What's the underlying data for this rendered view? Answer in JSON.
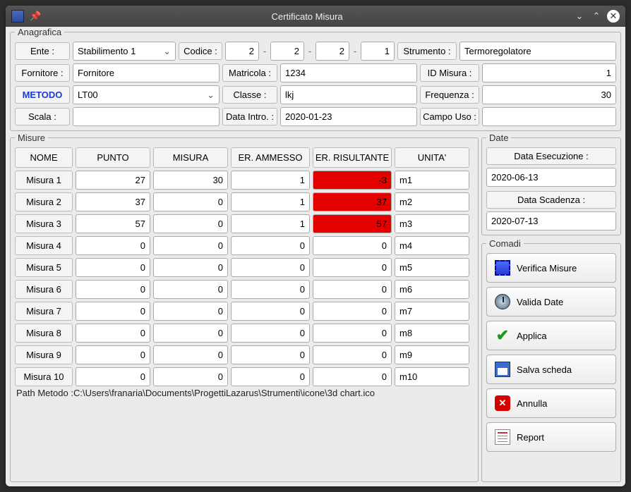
{
  "window": {
    "title": "Certificato Misura"
  },
  "anagrafica": {
    "legend": "Anagrafica",
    "ente_lbl": "Ente :",
    "ente_val": "Stabilimento 1",
    "codice_lbl": "Codice :",
    "codice": [
      "2",
      "2",
      "2",
      "1"
    ],
    "strumento_lbl": "Strumento :",
    "strumento_val": "Termoregolatore",
    "fornitore_lbl": "Fornitore :",
    "fornitore_val": "Fornitore",
    "matricola_lbl": "Matricola :",
    "matricola_val": "1234",
    "idmisura_lbl": "ID Misura :",
    "idmisura_val": "1",
    "metodo_lbl": "METODO",
    "metodo_val": "LT00",
    "classe_lbl": "Classe :",
    "classe_val": "lkj",
    "frequenza_lbl": "Frequenza :",
    "frequenza_val": "30",
    "scala_lbl": "Scala :",
    "scala_val": "",
    "dataintro_lbl": "Data Intro. :",
    "dataintro_val": "2020-01-23",
    "campouso_lbl": "Campo Uso :",
    "campouso_val": ""
  },
  "misure": {
    "legend": "Misure",
    "headers": [
      "NOME",
      "PUNTO",
      "MISURA",
      "ER. AMMESSO",
      "ER. RISULTANTE",
      "UNITA'"
    ],
    "rows": [
      {
        "nome": "Misura 1",
        "punto": "27",
        "misura": "30",
        "amm": "1",
        "ris": "-3",
        "unit": "m1",
        "err": true
      },
      {
        "nome": "Misura 2",
        "punto": "37",
        "misura": "0",
        "amm": "1",
        "ris": "37",
        "unit": "m2",
        "err": true
      },
      {
        "nome": "Misura 3",
        "punto": "57",
        "misura": "0",
        "amm": "1",
        "ris": "57",
        "unit": "m3",
        "err": true
      },
      {
        "nome": "Misura 4",
        "punto": "0",
        "misura": "0",
        "amm": "0",
        "ris": "0",
        "unit": "m4",
        "err": false
      },
      {
        "nome": "Misura 5",
        "punto": "0",
        "misura": "0",
        "amm": "0",
        "ris": "0",
        "unit": "m5",
        "err": false
      },
      {
        "nome": "Misura 6",
        "punto": "0",
        "misura": "0",
        "amm": "0",
        "ris": "0",
        "unit": "m6",
        "err": false
      },
      {
        "nome": "Misura 7",
        "punto": "0",
        "misura": "0",
        "amm": "0",
        "ris": "0",
        "unit": "m7",
        "err": false
      },
      {
        "nome": "Misura 8",
        "punto": "0",
        "misura": "0",
        "amm": "0",
        "ris": "0",
        "unit": "m8",
        "err": false
      },
      {
        "nome": "Misura 9",
        "punto": "0",
        "misura": "0",
        "amm": "0",
        "ris": "0",
        "unit": "m9",
        "err": false
      },
      {
        "nome": "Misura 10",
        "punto": "0",
        "misura": "0",
        "amm": "0",
        "ris": "0",
        "unit": "m10",
        "err": false
      }
    ],
    "path_lbl": "Path Metodo :",
    "path_val": "C:\\Users\\franaria\\Documents\\ProgettiLazarus\\Strumenti\\icone\\3d chart.ico"
  },
  "date": {
    "legend": "Date",
    "esec_lbl": "Data Esecuzione :",
    "esec_val": "2020-06-13",
    "scad_lbl": "Data Scadenza :",
    "scad_val": "2020-07-13"
  },
  "comandi": {
    "legend": "Comadi",
    "verifica": "Verifica Misure",
    "valida": "Valida Date",
    "applica": "Applica",
    "salva": "Salva scheda",
    "annulla": "Annulla",
    "report": "Report"
  }
}
